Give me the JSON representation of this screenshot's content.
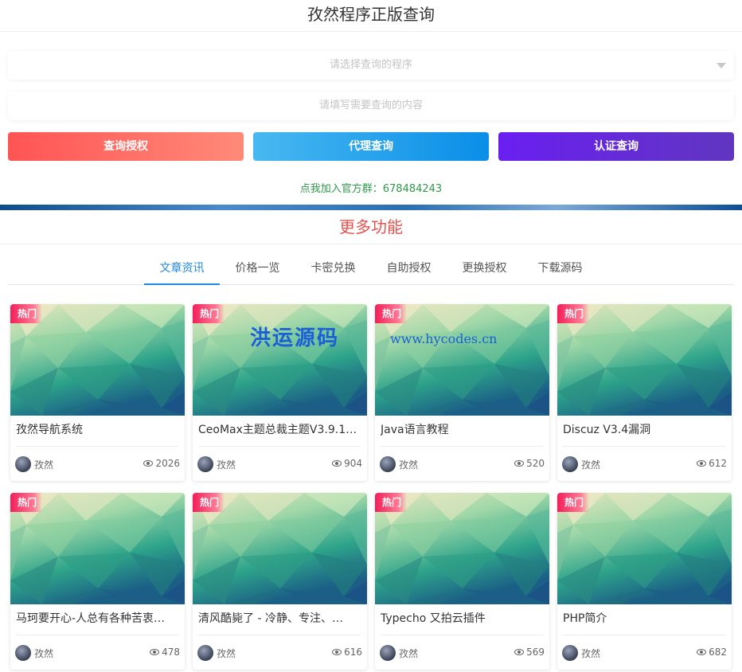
{
  "header": {
    "title": "孜然程序正版查询"
  },
  "form": {
    "program_select_placeholder": "请选择查询的程序",
    "content_input_placeholder": "请填写需要查询的内容"
  },
  "buttons": {
    "auth_query": "查询授权",
    "agent_query": "代理查询",
    "cert_query": "认证查询"
  },
  "group_link": "点我加入官方群：678484243",
  "more": {
    "title": "更多功能",
    "tabs": [
      "文章资讯",
      "价格一览",
      "卡密兑换",
      "自助授权",
      "更换授权",
      "下载源码"
    ],
    "active_tab": 0
  },
  "watermark": {
    "cn": "洪运源码",
    "url": "www.hycodes.cn"
  },
  "articles": [
    {
      "badge": "热门",
      "title": "孜然导航系统",
      "author": "孜然",
      "views": "2026"
    },
    {
      "badge": "热门",
      "title": "CeoMax主题总裁主题V3.9.1…",
      "author": "孜然",
      "views": "904"
    },
    {
      "badge": "热门",
      "title": "Java语言教程",
      "author": "孜然",
      "views": "520"
    },
    {
      "badge": "热门",
      "title": "Discuz V3.4漏洞",
      "author": "孜然",
      "views": "612"
    },
    {
      "badge": "热门",
      "title": "马珂要开心-人总有各种苦衷…",
      "author": "孜然",
      "views": "478"
    },
    {
      "badge": "热门",
      "title": "清风酷毙了 - 冷静、专注、…",
      "author": "孜然",
      "views": "616"
    },
    {
      "badge": "热门",
      "title": "Typecho 又拍云插件",
      "author": "孜然",
      "views": "569"
    },
    {
      "badge": "热门",
      "title": "PHP简介",
      "author": "孜然",
      "views": "682"
    }
  ]
}
